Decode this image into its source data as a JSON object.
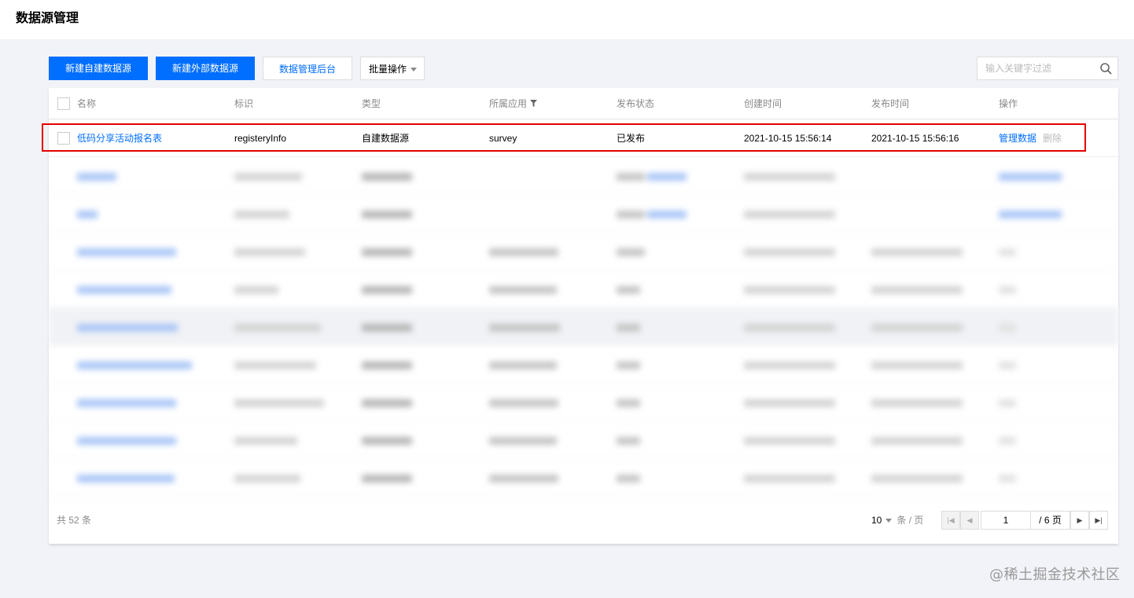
{
  "page": {
    "title": "数据源管理"
  },
  "toolbar": {
    "new_internal": "新建自建数据源",
    "new_external": "新建外部数据源",
    "admin_console": "数据管理后台",
    "batch_ops": "批量操作",
    "search_placeholder": "输入关键字过滤"
  },
  "table": {
    "columns": [
      "名称",
      "标识",
      "类型",
      "所属应用",
      "发布状态",
      "创建时间",
      "发布时间",
      "操作"
    ],
    "rows": [
      {
        "name": "低码分享活动报名表",
        "identifier": "registeryInfo",
        "type": "自建数据源",
        "app": "survey",
        "status": "已发布",
        "created": "2021-10-15 15:56:14",
        "published": "2021-10-15 15:56:16",
        "action_manage": "管理数据",
        "action_delete": "删除"
      }
    ]
  },
  "footer": {
    "total": "共 52 条",
    "page_size": "10",
    "page_size_unit": "条 / 页",
    "current_page": "1",
    "total_pages": "/ 6 页"
  },
  "watermark": "@稀土掘金技术社区",
  "colors": {
    "primary": "#006eff",
    "highlight": "#e50000",
    "background": "#f2f3f8"
  },
  "icons": [
    "search-icon",
    "filter-icon",
    "caret-down-icon",
    "first-page-icon",
    "prev-page-icon",
    "next-page-icon",
    "last-page-icon"
  ]
}
